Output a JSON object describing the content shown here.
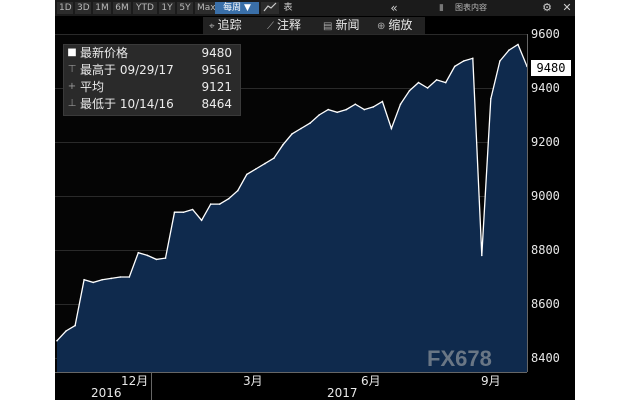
{
  "toolbar": {
    "ranges": [
      "1D",
      "3D",
      "1M",
      "6M",
      "YTD",
      "1Y",
      "5Y",
      "Max"
    ],
    "period_label": "每周 ▼",
    "table_label": "表",
    "collapse_icon": "«",
    "browse_label": "图表内容",
    "settings_icon": "⚙",
    "close_icon": "✕"
  },
  "subtoolbar": {
    "track": "追踪",
    "annotate": "注释",
    "news": "新闻",
    "zoom": "缩放"
  },
  "legend": {
    "last_label": "最新价格",
    "last_value": "9480",
    "high_label": "最高于 09/29/17",
    "high_value": "9561",
    "avg_label": "平均",
    "avg_value": "9121",
    "low_label": "最低于 10/14/16",
    "low_value": "8464"
  },
  "watermark": "FX678",
  "current_price_badge": "9480",
  "chart_data": {
    "type": "area",
    "ylim": [
      8400,
      9650
    ],
    "yticks": [
      9600,
      9400,
      9200,
      9000,
      8800,
      8600,
      8400
    ],
    "xticks": [
      "12月",
      "3月",
      "6月",
      "9月"
    ],
    "years": [
      "2016",
      "2017"
    ],
    "series": [
      {
        "values": [
          8464,
          8500,
          8520,
          8690,
          8680,
          8690,
          8695,
          8700,
          8700,
          8790,
          8780,
          8765,
          8770,
          8940,
          8940,
          8950,
          8910,
          8970,
          8970,
          8990,
          9020,
          9080,
          9100,
          9120,
          9140,
          9190,
          9230,
          9250,
          9270,
          9300,
          9320,
          9310,
          9320,
          9340,
          9320,
          9330,
          9350,
          9250,
          9340,
          9390,
          9420,
          9400,
          9430,
          9420,
          9480,
          9500,
          9510,
          8780,
          9360,
          9500,
          9540,
          9561,
          9480
        ]
      }
    ],
    "colors": {
      "fill": "#0f2a4d",
      "line": "#ffffff"
    }
  }
}
